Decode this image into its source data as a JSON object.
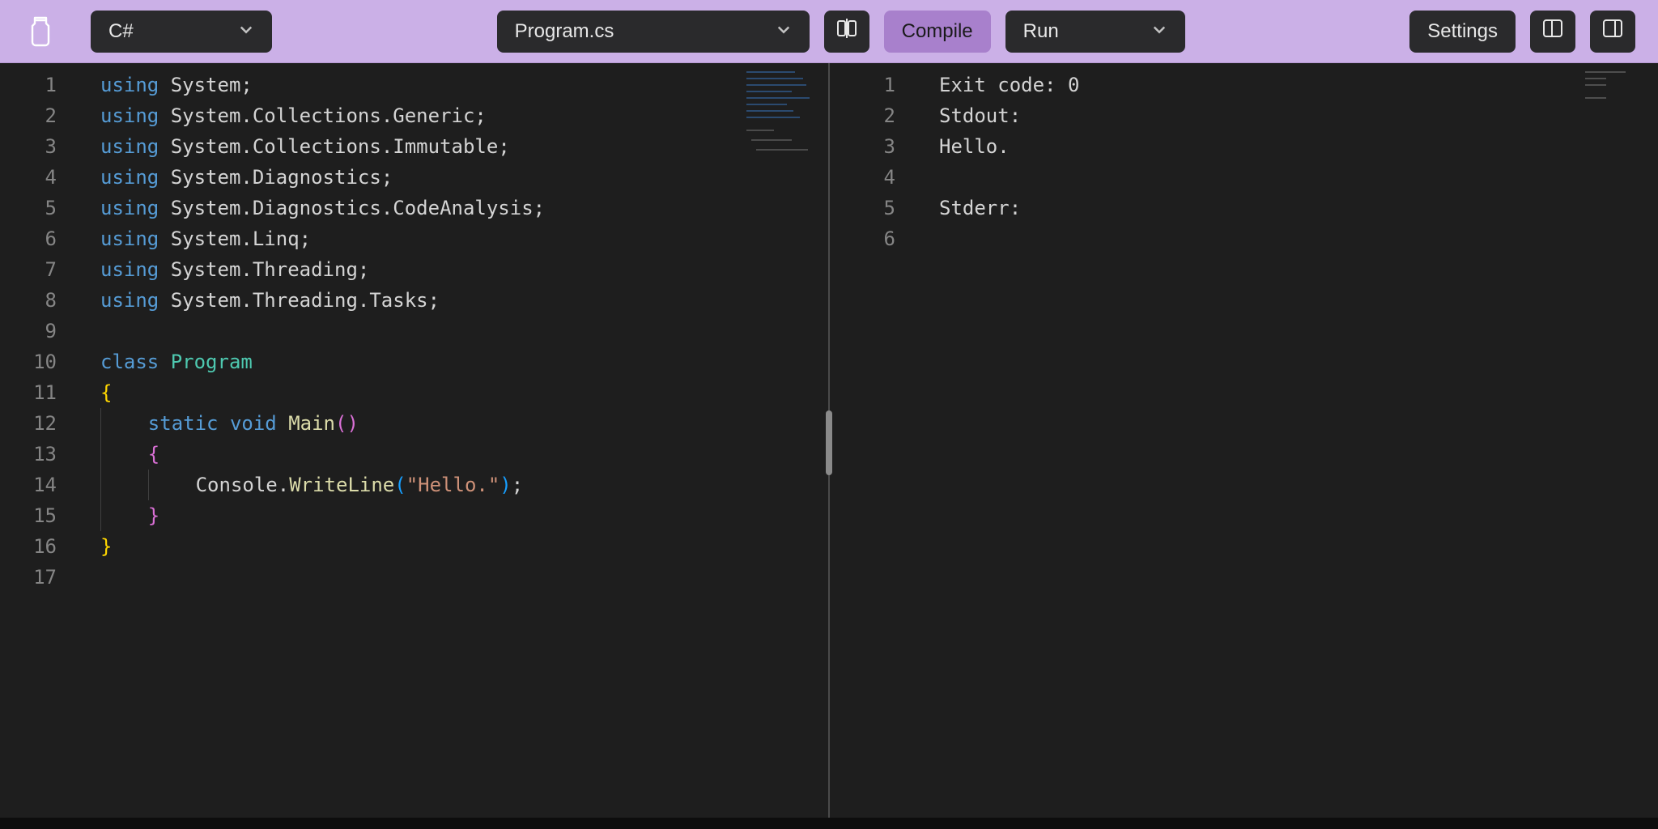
{
  "toolbar": {
    "language": "C#",
    "file": "Program.cs",
    "compile": "Compile",
    "run": "Run",
    "settings": "Settings"
  },
  "editor": {
    "lineCount": 17,
    "lines": [
      [
        [
          "kw",
          "using"
        ],
        [
          "sp",
          " "
        ],
        [
          "id",
          "System"
        ],
        [
          "p",
          ";"
        ]
      ],
      [
        [
          "kw",
          "using"
        ],
        [
          "sp",
          " "
        ],
        [
          "id",
          "System"
        ],
        [
          "p",
          "."
        ],
        [
          "id",
          "Collections"
        ],
        [
          "p",
          "."
        ],
        [
          "id",
          "Generic"
        ],
        [
          "p",
          ";"
        ]
      ],
      [
        [
          "kw",
          "using"
        ],
        [
          "sp",
          " "
        ],
        [
          "id",
          "System"
        ],
        [
          "p",
          "."
        ],
        [
          "id",
          "Collections"
        ],
        [
          "p",
          "."
        ],
        [
          "id",
          "Immutable"
        ],
        [
          "p",
          ";"
        ]
      ],
      [
        [
          "kw",
          "using"
        ],
        [
          "sp",
          " "
        ],
        [
          "id",
          "System"
        ],
        [
          "p",
          "."
        ],
        [
          "id",
          "Diagnostics"
        ],
        [
          "p",
          ";"
        ]
      ],
      [
        [
          "kw",
          "using"
        ],
        [
          "sp",
          " "
        ],
        [
          "id",
          "System"
        ],
        [
          "p",
          "."
        ],
        [
          "id",
          "Diagnostics"
        ],
        [
          "p",
          "."
        ],
        [
          "id",
          "CodeAnalysis"
        ],
        [
          "p",
          ";"
        ]
      ],
      [
        [
          "kw",
          "using"
        ],
        [
          "sp",
          " "
        ],
        [
          "id",
          "System"
        ],
        [
          "p",
          "."
        ],
        [
          "id",
          "Linq"
        ],
        [
          "p",
          ";"
        ]
      ],
      [
        [
          "kw",
          "using"
        ],
        [
          "sp",
          " "
        ],
        [
          "id",
          "System"
        ],
        [
          "p",
          "."
        ],
        [
          "id",
          "Threading"
        ],
        [
          "p",
          ";"
        ]
      ],
      [
        [
          "kw",
          "using"
        ],
        [
          "sp",
          " "
        ],
        [
          "id",
          "System"
        ],
        [
          "p",
          "."
        ],
        [
          "id",
          "Threading"
        ],
        [
          "p",
          "."
        ],
        [
          "id",
          "Tasks"
        ],
        [
          "p",
          ";"
        ]
      ],
      [],
      [
        [
          "kw",
          "class"
        ],
        [
          "sp",
          " "
        ],
        [
          "cls",
          "Program"
        ]
      ],
      [
        [
          "br",
          "{"
        ]
      ],
      [
        [
          "ind",
          1
        ],
        [
          "kw",
          "static"
        ],
        [
          "sp",
          " "
        ],
        [
          "kw2",
          "void"
        ],
        [
          "sp",
          " "
        ],
        [
          "fn",
          "Main"
        ],
        [
          "br2",
          "("
        ],
        [
          "br2",
          ")"
        ]
      ],
      [
        [
          "ind",
          1
        ],
        [
          "br2",
          "{"
        ]
      ],
      [
        [
          "ind",
          2
        ],
        [
          "id",
          "Console"
        ],
        [
          "p",
          "."
        ],
        [
          "fn",
          "WriteLine"
        ],
        [
          "br3",
          "("
        ],
        [
          "str",
          "\"Hello.\""
        ],
        [
          "br3",
          ")"
        ],
        [
          "p",
          ";"
        ]
      ],
      [
        [
          "ind",
          1
        ],
        [
          "br2",
          "}"
        ]
      ],
      [
        [
          "br",
          "}"
        ]
      ],
      []
    ]
  },
  "output": {
    "lineCount": 6,
    "lines": [
      "Exit code: 0",
      "Stdout:",
      "Hello.",
      "",
      "Stderr:",
      ""
    ]
  }
}
